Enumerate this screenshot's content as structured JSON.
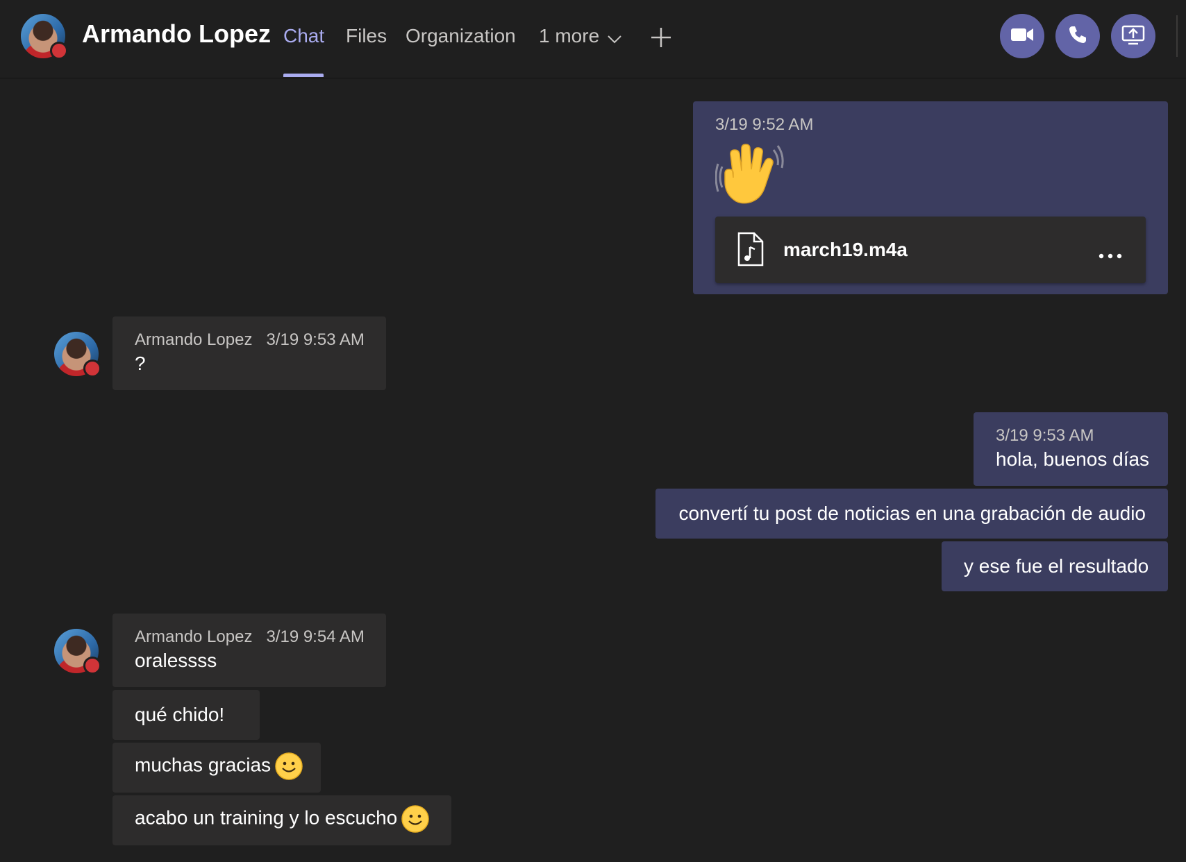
{
  "header": {
    "title": "Armando Lopez",
    "tabs": [
      {
        "label": "Chat",
        "active": true
      },
      {
        "label": "Files",
        "active": false
      },
      {
        "label": "Organization",
        "active": false
      },
      {
        "label": "1 more",
        "active": false
      }
    ],
    "accent_color": "#6264a7",
    "icons": [
      "video-call-icon",
      "audio-call-icon",
      "share-screen-icon",
      "add-tab-icon"
    ]
  },
  "contact": {
    "name": "Armando Lopez",
    "presence": "busy",
    "presence_color": "#d13438"
  },
  "messages": {
    "m1": {
      "time": "3/19 9:52 AM",
      "emoji": "waving-hand",
      "file_name": "march19.m4a"
    },
    "m2": {
      "author": "Armando Lopez",
      "time": "3/19 9:53 AM",
      "text": "?"
    },
    "m3": {
      "time": "3/19 9:53 AM",
      "text": "hola, buenos días"
    },
    "m4": {
      "text": "convertí tu post de noticias en una grabación de audio"
    },
    "m5": {
      "text": "y ese fue el resultado"
    },
    "m6": {
      "author": "Armando Lopez",
      "time": "3/19 9:54 AM",
      "text": "oralessss"
    },
    "m7": {
      "text": "qué chido!"
    },
    "m8": {
      "text": "muchas gracias",
      "emoji": "smile"
    },
    "m9": {
      "text": "acabo un training y lo escucho",
      "emoji": "smile"
    }
  }
}
